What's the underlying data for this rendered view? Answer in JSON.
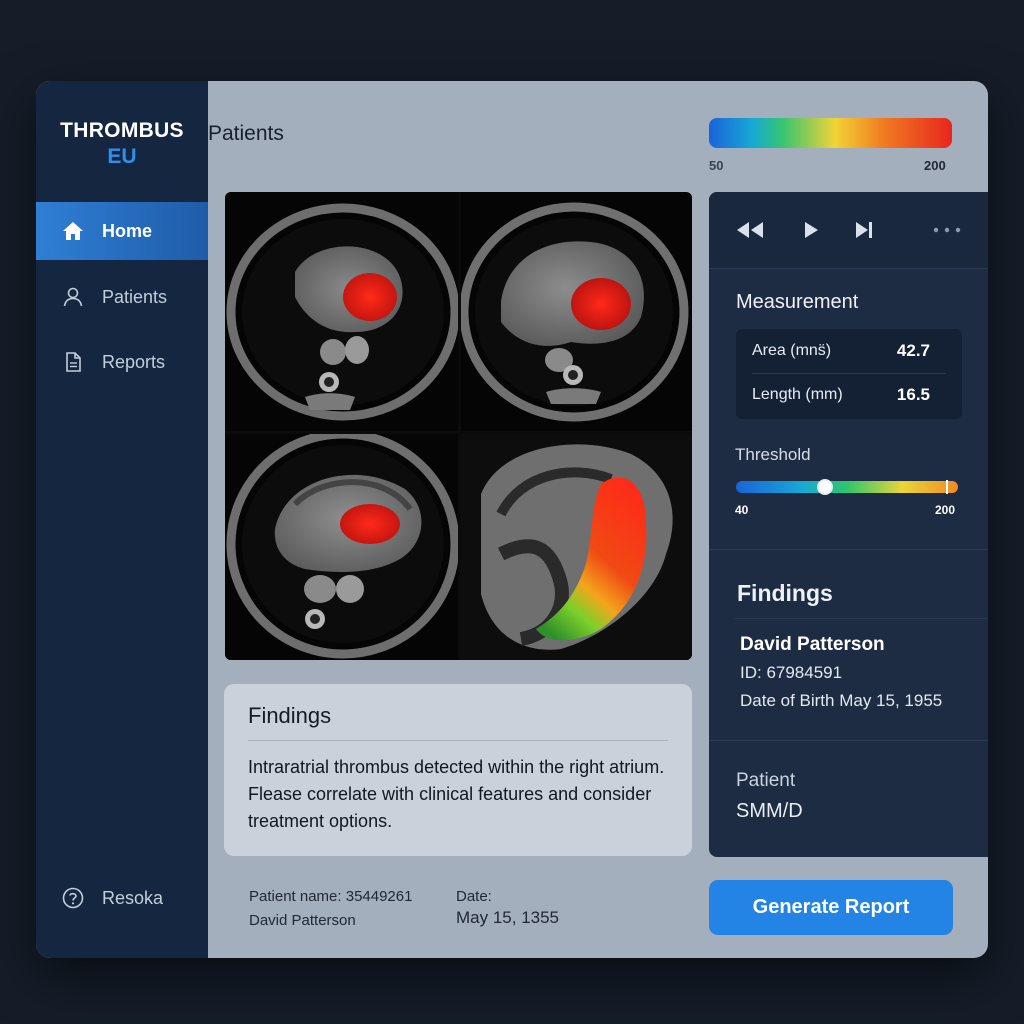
{
  "app": {
    "brand_line1": "THROMBUS",
    "brand_line2": "EU"
  },
  "sidebar": {
    "items": [
      {
        "label": "Home",
        "icon": "home-icon",
        "active": true
      },
      {
        "label": "Patients",
        "icon": "user-icon",
        "active": false
      },
      {
        "label": "Reports",
        "icon": "document-icon",
        "active": false
      }
    ],
    "bottom_item": {
      "label": "Resoka",
      "icon": "help-icon"
    }
  },
  "header": {
    "title": "Patients",
    "color_scale": {
      "min_label": "50",
      "max_label": "200"
    }
  },
  "findings_card": {
    "title": "Findings",
    "text": "Intraratrial thrombus detected within the right atrium. Flease correlate with clinical features and consider treatment options."
  },
  "footer": {
    "patient_name_label": "Patient name: 35449261",
    "patient_name_value": "David Patterson",
    "date_label": "Date:",
    "date_value": "May  15, 1355",
    "generate_button": "Generate Report"
  },
  "right_panel": {
    "measurement": {
      "title": "Measurement",
      "rows": [
        {
          "label": "Area (mns̈)",
          "value": "42.7"
        },
        {
          "label": "Length (mm)",
          "value": "16.5"
        }
      ]
    },
    "threshold": {
      "label": "Threshold",
      "min": "40",
      "max": "200",
      "level_fraction": 0.4
    },
    "findings": {
      "title": "Findings",
      "patient_name": "David Patterson",
      "id_line": "ID: 67984591",
      "dob_line": "Date of Birth  May  15, 1955"
    },
    "patient": {
      "label": "Patient",
      "value": "SMM/D"
    }
  },
  "colors": {
    "accent": "#2384e6",
    "sidebar_bg": "#142640",
    "brand_blue": "#2f8ff0",
    "highlight_red": "#e8261d"
  }
}
